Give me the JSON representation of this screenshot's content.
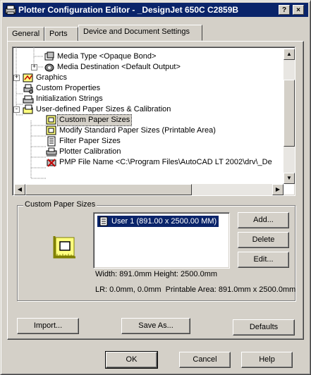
{
  "window": {
    "title": "Plotter Configuration Editor - _DesignJet 650C C2859B",
    "help_button": "?",
    "close_button": "×"
  },
  "tabs": [
    {
      "label": "General"
    },
    {
      "label": "Ports"
    },
    {
      "label": "Device and Document Settings"
    }
  ],
  "tree": {
    "items": [
      {
        "label": "Media Type <Opaque Bond>",
        "icon": "media-type-icon"
      },
      {
        "label": "Media Destination <Default Output>",
        "icon": "media-destination-icon",
        "expander": "+"
      },
      {
        "label": "Graphics",
        "icon": "graphics-icon",
        "expander": "+"
      },
      {
        "label": "Custom Properties",
        "icon": "custom-properties-icon"
      },
      {
        "label": "Initialization Strings",
        "icon": "initialization-strings-icon"
      },
      {
        "label": "User-defined Paper Sizes & Calibration",
        "icon": "paper-sizes-folder-icon",
        "expander": "-"
      },
      {
        "label": "Custom Paper Sizes",
        "icon": "custom-paper-sizes-icon",
        "selected": true
      },
      {
        "label": "Modify Standard Paper Sizes (Printable Area)",
        "icon": "modify-paper-sizes-icon"
      },
      {
        "label": "Filter Paper Sizes",
        "icon": "filter-paper-sizes-icon"
      },
      {
        "label": "Plotter Calibration",
        "icon": "plotter-calibration-icon"
      },
      {
        "label": "PMP File Name <C:\\Program Files\\AutoCAD LT 2002\\drv\\_De",
        "icon": "pmp-file-icon"
      }
    ]
  },
  "custom_paper_sizes": {
    "group_title": "Custom Paper Sizes",
    "list_items": [
      {
        "label": "User 1 (891.00 x 2500.00 MM)",
        "selected": true
      }
    ],
    "add_button": "Add...",
    "delete_button": "Delete",
    "edit_button": "Edit...",
    "size_info": "Width: 891.0mm Height: 2500.0mm",
    "printable_info": "LR: 0.0mm, 0.0mm  Printable Area: 891.0mm x 2500.0mm"
  },
  "actions": {
    "import_button": "Import...",
    "save_as_button": "Save As...",
    "defaults_button": "Defaults"
  },
  "dialog_buttons": {
    "ok": "OK",
    "cancel": "Cancel",
    "help": "Help"
  },
  "colors": {
    "titlebar": "#0a246a",
    "face": "#d4d0c8",
    "selection": "#0a246a"
  }
}
